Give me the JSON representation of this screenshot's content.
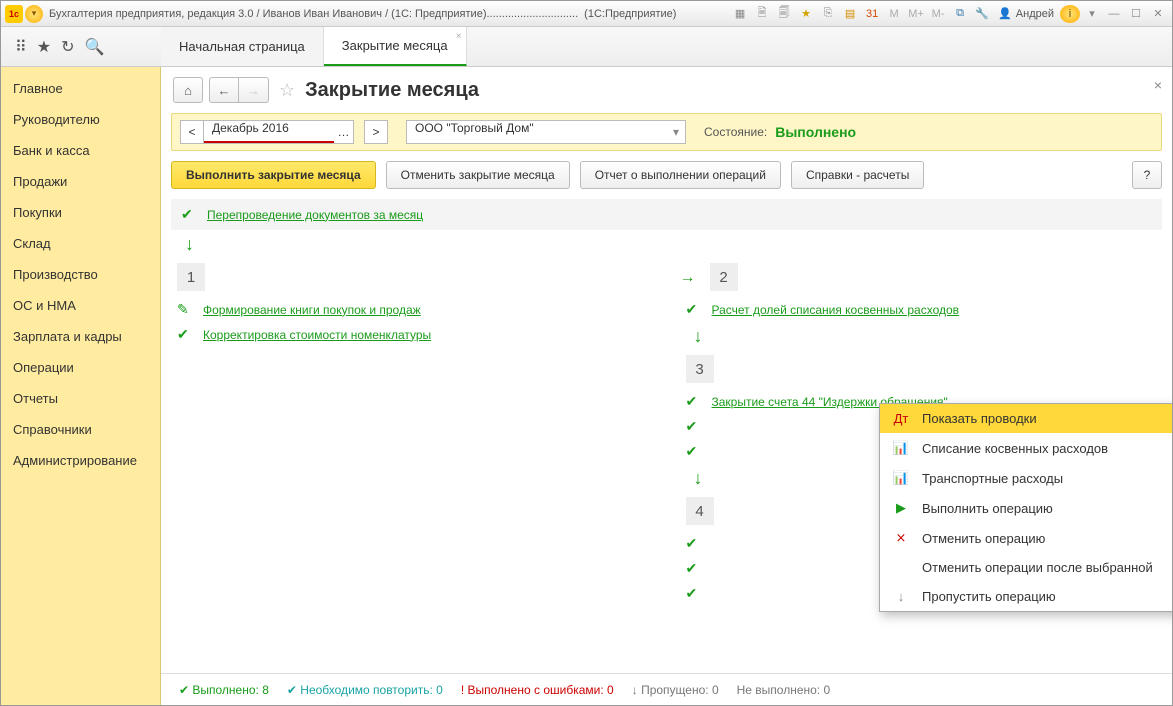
{
  "titlebar": {
    "title_left": "Бухгалтерия предприятия, редакция 3.0 / Иванов Иван Иванович / (1С: Предприятие)..............................",
    "title_right": "(1С:Предприятие)",
    "user": "Андрей"
  },
  "tabs": {
    "start": "Начальная страница",
    "current": "Закрытие месяца"
  },
  "sidebar": {
    "items": [
      "Главное",
      "Руководителю",
      "Банк и касса",
      "Продажи",
      "Покупки",
      "Склад",
      "Производство",
      "ОС и НМА",
      "Зарплата и кадры",
      "Операции",
      "Отчеты",
      "Справочники",
      "Администрирование"
    ]
  },
  "page": {
    "title": "Закрытие месяца",
    "period": "Декабрь 2016",
    "org": "ООО \"Торговый Дом\"",
    "state_label": "Состояние:",
    "state_value": "Выполнено",
    "btn_execute": "Выполнить закрытие месяца",
    "btn_cancel": "Отменить закрытие месяца",
    "btn_report": "Отчет о выполнении операций",
    "btn_refs": "Справки - расчеты",
    "help": "?"
  },
  "stages": {
    "repost": "Перепроведение документов за месяц",
    "s1a": "Формирование книги покупок и продаж",
    "s1b": "Корректировка стоимости номенклатуры",
    "s2a": "Расчет долей списания косвенных расходов",
    "s3a": "Закрытие счета 44 \"Издержки обращения\"",
    "num1": "1",
    "num2": "2",
    "num3": "3",
    "num4": "4"
  },
  "ctx": {
    "i1": "Показать проводки",
    "i2": "Списание косвенных расходов",
    "i3": "Транспортные расходы",
    "i4": "Выполнить операцию",
    "i5": "Отменить операцию",
    "i6": "Отменить операции после выбранной",
    "i7": "Пропустить операцию"
  },
  "footer": {
    "done_l": "Выполнено:",
    "done_v": "8",
    "redo_l": "Необходимо повторить:",
    "redo_v": "0",
    "err_l": "Выполнено с ошибками:",
    "err_v": "0",
    "skip_l": "Пропущено:",
    "skip_v": "0",
    "not_l": "Не выполнено:",
    "not_v": "0"
  }
}
